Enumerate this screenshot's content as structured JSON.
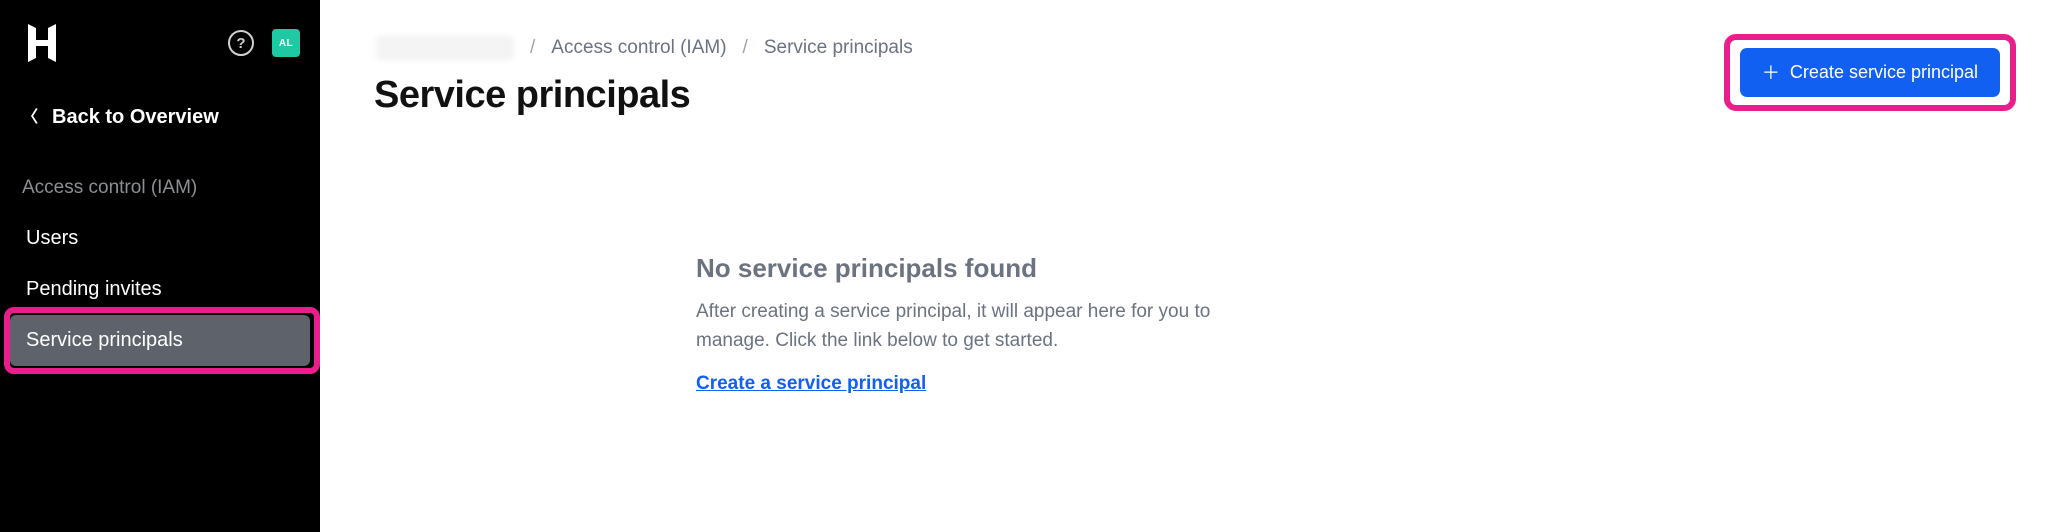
{
  "sidebar": {
    "avatar_initials": "AL",
    "back_label": "Back to Overview",
    "section_label": "Access control (IAM)",
    "items": [
      {
        "label": "Users"
      },
      {
        "label": "Pending invites"
      },
      {
        "label": "Service principals"
      }
    ]
  },
  "breadcrumb": {
    "iam": "Access control (IAM)",
    "current": "Service principals"
  },
  "page_title": "Service principals",
  "create_button": "Create service principal",
  "empty": {
    "title": "No service principals found",
    "desc": "After creating a service principal, it will appear here for you to manage. Click the link below to get started.",
    "link": "Create a service principal"
  }
}
